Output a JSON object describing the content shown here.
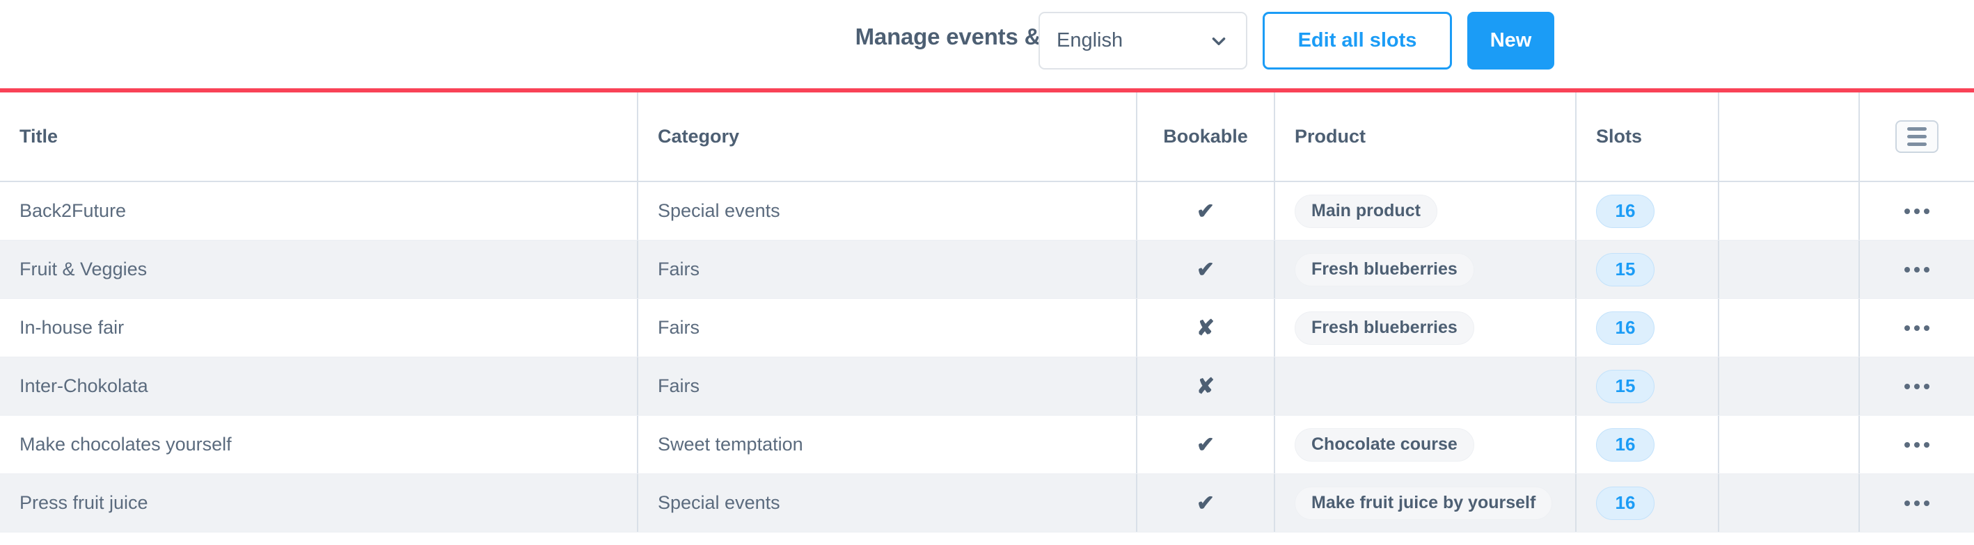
{
  "header": {
    "title": "Manage events & tickets",
    "language_select": {
      "value": "English",
      "icon": "chevron-down-icon"
    },
    "edit_all_slots_label": "Edit all slots",
    "new_label": "New"
  },
  "theme": {
    "accent_red": "#f94257",
    "primary_blue": "#1b9cf6",
    "text_slate": "#4d5f73",
    "row_stripe": "#f0f2f5",
    "badge_bg": "#ddeffd",
    "chip_bg": "#f5f6f8"
  },
  "table": {
    "columns": [
      {
        "key": "title",
        "label": "Title"
      },
      {
        "key": "category",
        "label": "Category"
      },
      {
        "key": "bookable",
        "label": "Bookable"
      },
      {
        "key": "product",
        "label": "Product"
      },
      {
        "key": "slots",
        "label": "Slots"
      },
      {
        "key": "blank",
        "label": ""
      },
      {
        "key": "actions",
        "label": "",
        "icon": "hamburger-menu-icon"
      }
    ],
    "rows": [
      {
        "title": "Back2Future",
        "category": "Special events",
        "bookable": "✔",
        "product": "Main product",
        "slots": "16",
        "actions": "kebab-menu-icon"
      },
      {
        "title": "Fruit & Veggies",
        "category": "Fairs",
        "bookable": "✔",
        "product": "Fresh blueberries",
        "slots": "15",
        "actions": "kebab-menu-icon"
      },
      {
        "title": "In-house fair",
        "category": "Fairs",
        "bookable": "✘",
        "product": "Fresh blueberries",
        "slots": "16",
        "actions": "kebab-menu-icon"
      },
      {
        "title": "Inter-Chokolata",
        "category": "Fairs",
        "bookable": "✘",
        "product": "",
        "slots": "15",
        "actions": "kebab-menu-icon"
      },
      {
        "title": "Make chocolates yourself",
        "category": "Sweet temptation",
        "bookable": "✔",
        "product": "Chocolate course",
        "slots": "16",
        "actions": "kebab-menu-icon"
      },
      {
        "title": "Press fruit juice",
        "category": "Special events",
        "bookable": "✔",
        "product": "Make fruit juice by yourself",
        "slots": "16",
        "actions": "kebab-menu-icon"
      }
    ]
  }
}
